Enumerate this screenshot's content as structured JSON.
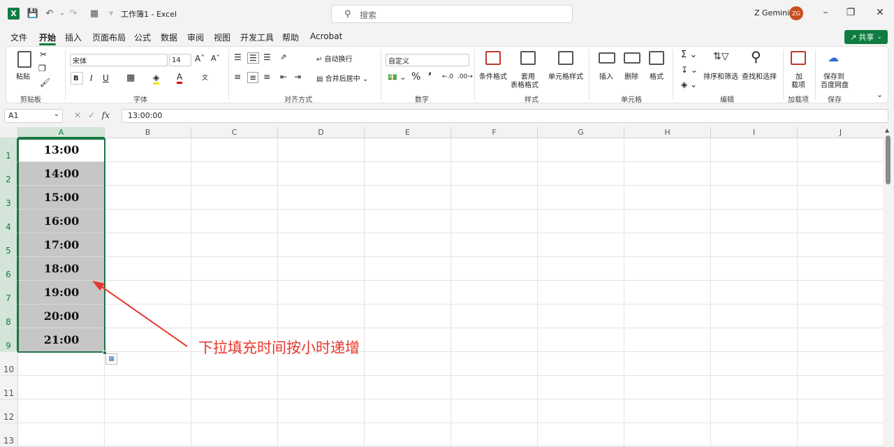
{
  "titlebar": {
    "document_title": "工作簿1  -  Excel",
    "search_placeholder": "搜索",
    "user_name": "Z Gemini",
    "avatar_initials": "ZG"
  },
  "menu": {
    "items": [
      "文件",
      "开始",
      "插入",
      "页面布局",
      "公式",
      "数据",
      "审阅",
      "视图",
      "开发工具",
      "帮助",
      "Acrobat"
    ],
    "active": "开始",
    "share_label": "共享"
  },
  "ribbon": {
    "clipboard": {
      "paste_label": "粘贴",
      "group_label": "剪贴板"
    },
    "font": {
      "font_name": "宋体",
      "font_size": "14",
      "group_label": "字体",
      "bold": "B",
      "italic": "I",
      "underline": "U"
    },
    "alignment": {
      "wrap_label": "自动换行",
      "merge_label": "合并后居中",
      "group_label": "对齐方式"
    },
    "number": {
      "format_value": "自定义",
      "group_label": "数字"
    },
    "styles": {
      "conditional_label": "条件格式",
      "table_label_1": "套用",
      "table_label_2": "表格格式",
      "cell_styles_label": "单元格样式",
      "group_label": "样式"
    },
    "cells": {
      "insert_label": "插入",
      "delete_label": "删除",
      "format_label": "格式",
      "group_label": "单元格"
    },
    "editing": {
      "sort_label": "排序和筛选",
      "find_label": "查找和选择",
      "group_label": "编辑"
    },
    "addins": {
      "label_1": "加",
      "label_2": "载项",
      "group_label": "加载项"
    },
    "save": {
      "label_1": "保存到",
      "label_2": "百度网盘",
      "group_label": "保存"
    }
  },
  "formula_bar": {
    "name_box": "A1",
    "fx": "fx",
    "formula": "13:00:00"
  },
  "grid": {
    "columns": [
      "A",
      "B",
      "C",
      "D",
      "E",
      "F",
      "G",
      "H",
      "I",
      "J"
    ],
    "rows": [
      "1",
      "2",
      "3",
      "4",
      "5",
      "6",
      "7",
      "8",
      "9",
      "10",
      "11",
      "12",
      "13"
    ],
    "column_a_values": [
      "13:00",
      "14:00",
      "15:00",
      "16:00",
      "17:00",
      "18:00",
      "19:00",
      "20:00",
      "21:00"
    ]
  },
  "annotation": {
    "text": "下拉填充时间按小时递增",
    "color": "#e8372e"
  },
  "colors": {
    "accent": "#107c41",
    "selection_fill": "#c6c6c6",
    "avatar": "#c8501e"
  }
}
